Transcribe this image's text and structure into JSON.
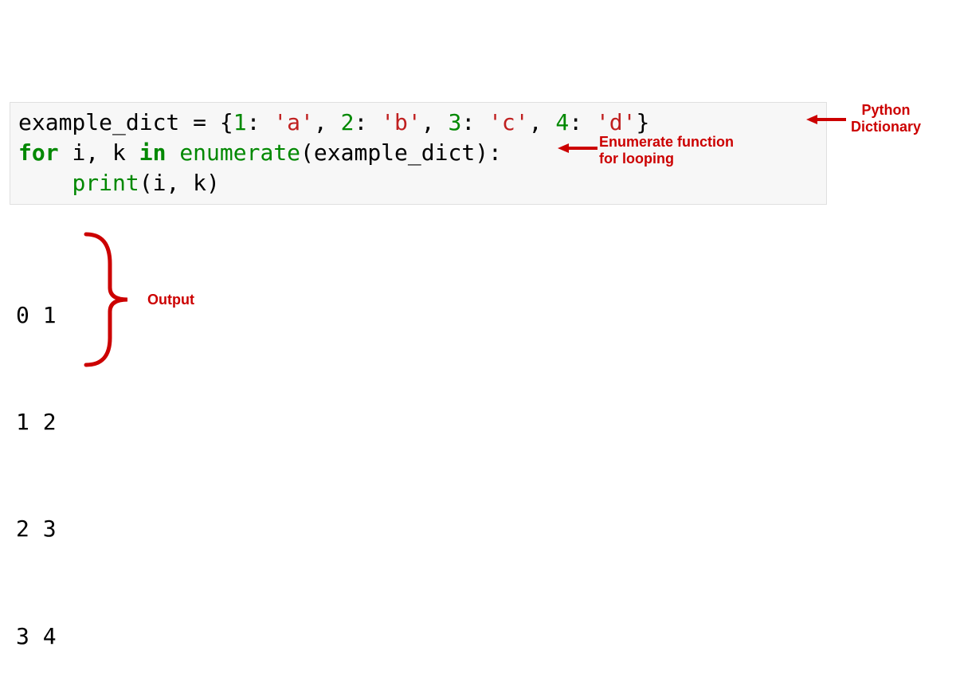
{
  "code": {
    "line1": {
      "var": "example_dict",
      "assign": " = ",
      "open": "{",
      "k1": "1",
      "c1": ": ",
      "v1": "'a'",
      "s1": ", ",
      "k2": "2",
      "c2": ": ",
      "v2": "'b'",
      "s2": ", ",
      "k3": "3",
      "c3": ": ",
      "v3": "'c'",
      "s3": ", ",
      "k4": "4",
      "c4": ": ",
      "v4": "'d'",
      "close": "}"
    },
    "line2": {
      "for": "for",
      "sp1": " ",
      "i": "i",
      "comma": ", ",
      "k": "k",
      "sp2": " ",
      "in": "in",
      "sp3": " ",
      "enumerate": "enumerate",
      "open": "(",
      "arg": "example_dict",
      "close": "):"
    },
    "line3": {
      "indent": "    ",
      "print": "print",
      "open": "(",
      "arg1": "i",
      "comma": ", ",
      "arg2": "k",
      "close": ")"
    }
  },
  "output": {
    "l1": "0 1",
    "l2": "1 2",
    "l3": "2 3",
    "l4": "3 4"
  },
  "annotations": {
    "dict1": "Python",
    "dict2": "Dictionary",
    "enum1": "Enumerate function",
    "enum2": "for looping",
    "output": "Output"
  }
}
